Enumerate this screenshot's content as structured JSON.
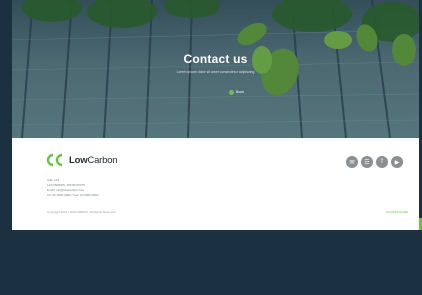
{
  "hero": {
    "title": "Contact us",
    "subtitle": "Lorem ipsum dolor sit amet consectetur adipiscing",
    "button_label": "Book"
  },
  "footer": {
    "brand": {
      "name_bold": "Low",
      "name_rest": "Carbon"
    },
    "contact_lines": [
      "Add: 123",
      "1234 BRKDS, 456 89 56475",
      "Email: info@lowcarbon.com",
      "Tel: 00 0000 0000 / Fax: 00 0000 0000"
    ],
    "copyright": "Copyright 2024 LOWCARBON. All Rights Reserved.",
    "link_label": "ACCESS MORE",
    "socials": [
      {
        "icon": "mail-icon",
        "glyph": "✉"
      },
      {
        "icon": "chat-icon",
        "glyph": "☰"
      },
      {
        "icon": "facebook-icon",
        "glyph": "f"
      },
      {
        "icon": "video-icon",
        "glyph": "▶"
      }
    ]
  },
  "colors": {
    "accent": "#6cc04a",
    "background": "#1b3141"
  }
}
